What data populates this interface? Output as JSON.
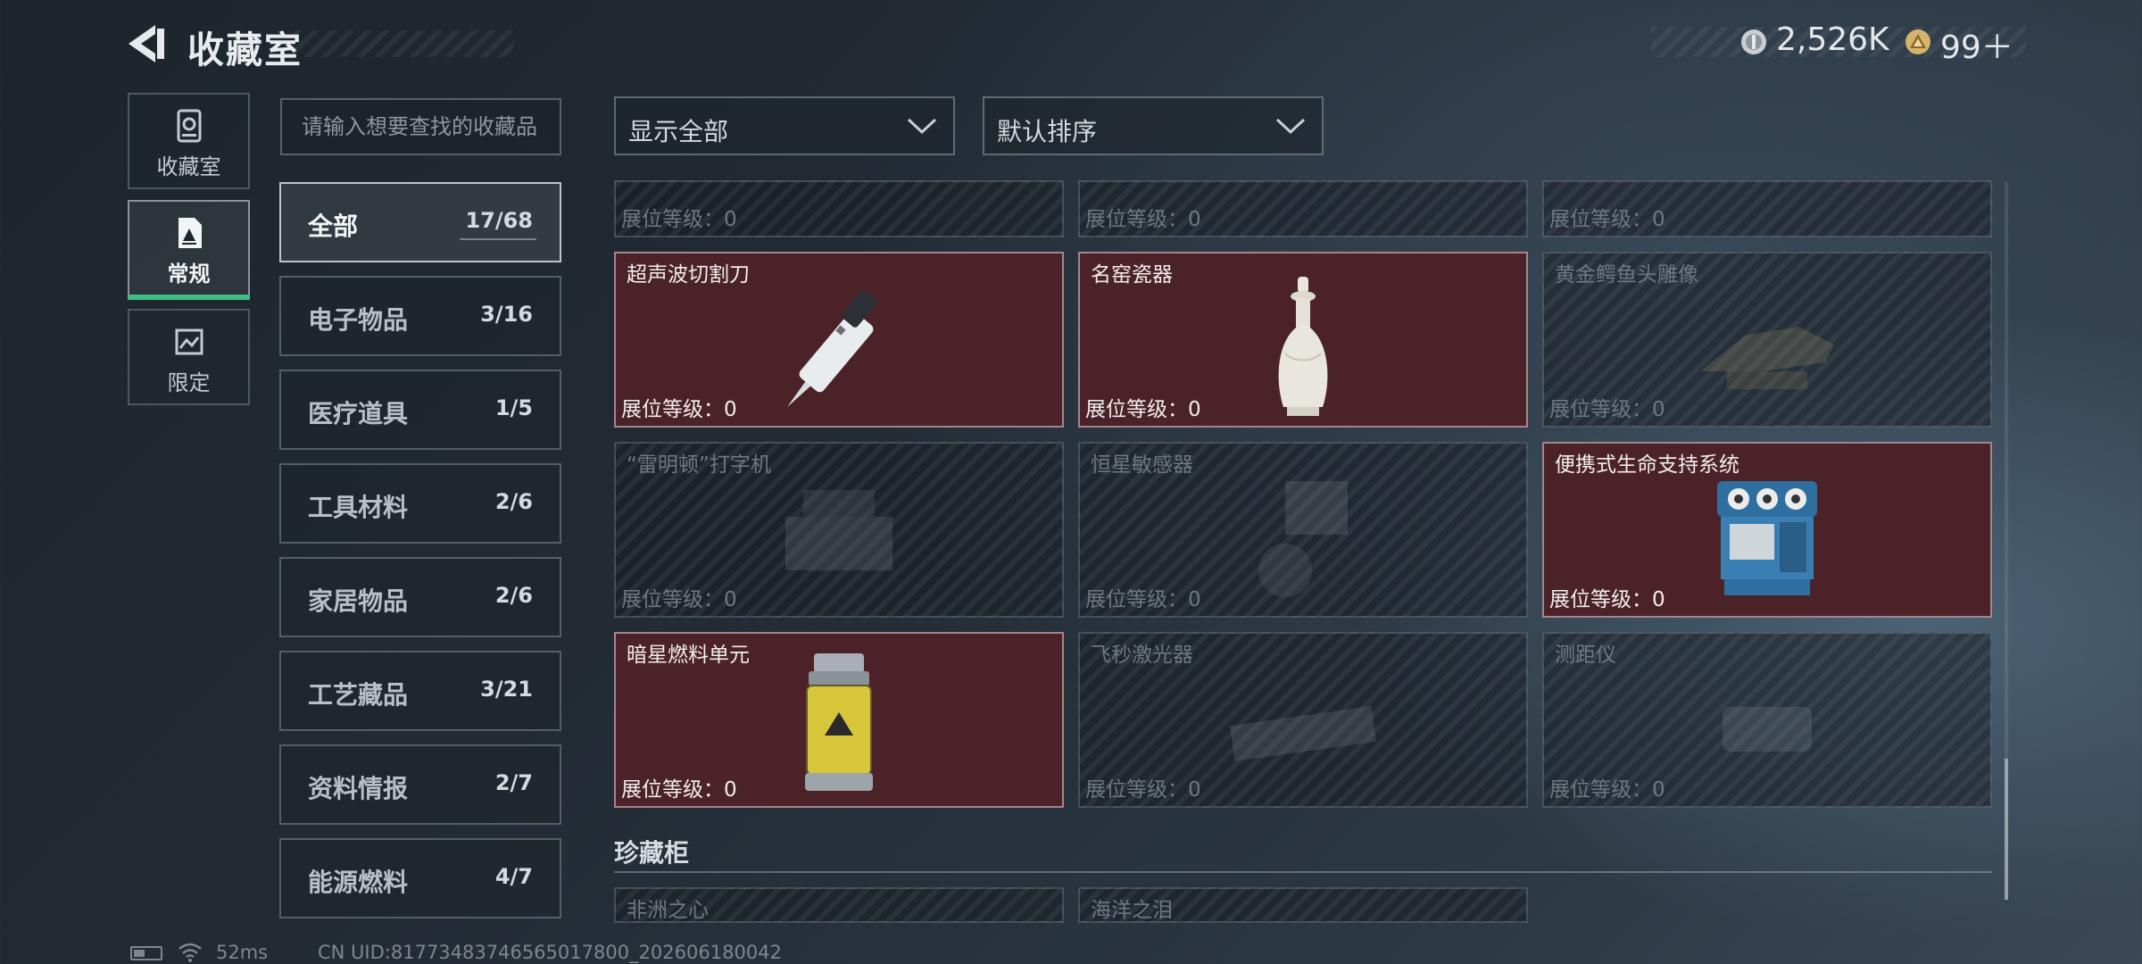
{
  "header": {
    "title": "收藏室",
    "coin_value": "2,526K",
    "token_value": "99＋"
  },
  "side_tabs": [
    {
      "label": "收藏室",
      "icon": "vault-icon",
      "active": false
    },
    {
      "label": "常规",
      "icon": "document-icon",
      "active": true
    },
    {
      "label": "限定",
      "icon": "image-frame-icon",
      "active": false
    }
  ],
  "search": {
    "placeholder": "请输入想要查找的收藏品"
  },
  "categories": [
    {
      "name": "全部",
      "count": "17/68",
      "active": true
    },
    {
      "name": "电子物品",
      "count": "3/16"
    },
    {
      "name": "医疗道具",
      "count": "1/5"
    },
    {
      "name": "工具材料",
      "count": "2/6"
    },
    {
      "name": "家居物品",
      "count": "2/6"
    },
    {
      "name": "工艺藏品",
      "count": "3/21"
    },
    {
      "name": "资料情报",
      "count": "2/7"
    },
    {
      "name": "能源燃料",
      "count": "4/7"
    }
  ],
  "filters": {
    "display": "显示全部",
    "sort": "默认排序"
  },
  "partial_row": [
    {
      "level": "展位等级：0"
    },
    {
      "level": "展位等级：0"
    },
    {
      "level": "展位等级：0"
    }
  ],
  "items": [
    {
      "name": "超声波切割刀",
      "level": "展位等级：0",
      "owned": true,
      "icon": "ultrasonic-knife-icon"
    },
    {
      "name": "名窑瓷器",
      "level": "展位等级：0",
      "owned": true,
      "icon": "porcelain-vase-icon"
    },
    {
      "name": "黄金鳄鱼头雕像",
      "level": "展位等级：0",
      "owned": false,
      "icon": "gold-crocodile-statue-icon"
    },
    {
      "name": "“雷明顿”打字机",
      "level": "展位等级：0",
      "owned": false,
      "icon": "typewriter-icon"
    },
    {
      "name": "恒星敏感器",
      "level": "展位等级：0",
      "owned": false,
      "icon": "star-sensor-icon"
    },
    {
      "name": "便携式生命支持系统",
      "level": "展位等级：0",
      "owned": true,
      "icon": "life-support-system-icon"
    },
    {
      "name": "暗星燃料单元",
      "level": "展位等级：0",
      "owned": true,
      "icon": "fuel-canister-icon"
    },
    {
      "name": "飞秒激光器",
      "level": "展位等级：0",
      "owned": false,
      "icon": "laser-device-icon"
    },
    {
      "name": "测距仪",
      "level": "展位等级：0",
      "owned": false,
      "icon": "rangefinder-icon"
    }
  ],
  "section": {
    "title": "珍藏柜",
    "items": [
      {
        "name": "非洲之心"
      },
      {
        "name": "海洋之泪"
      }
    ]
  },
  "status": {
    "ping": "52ms",
    "uid": "CN UID:817734837465650178​00_202606180042"
  },
  "colors": {
    "owned_card": "#4b2228",
    "active_tab_accent": "#3fbf86"
  }
}
